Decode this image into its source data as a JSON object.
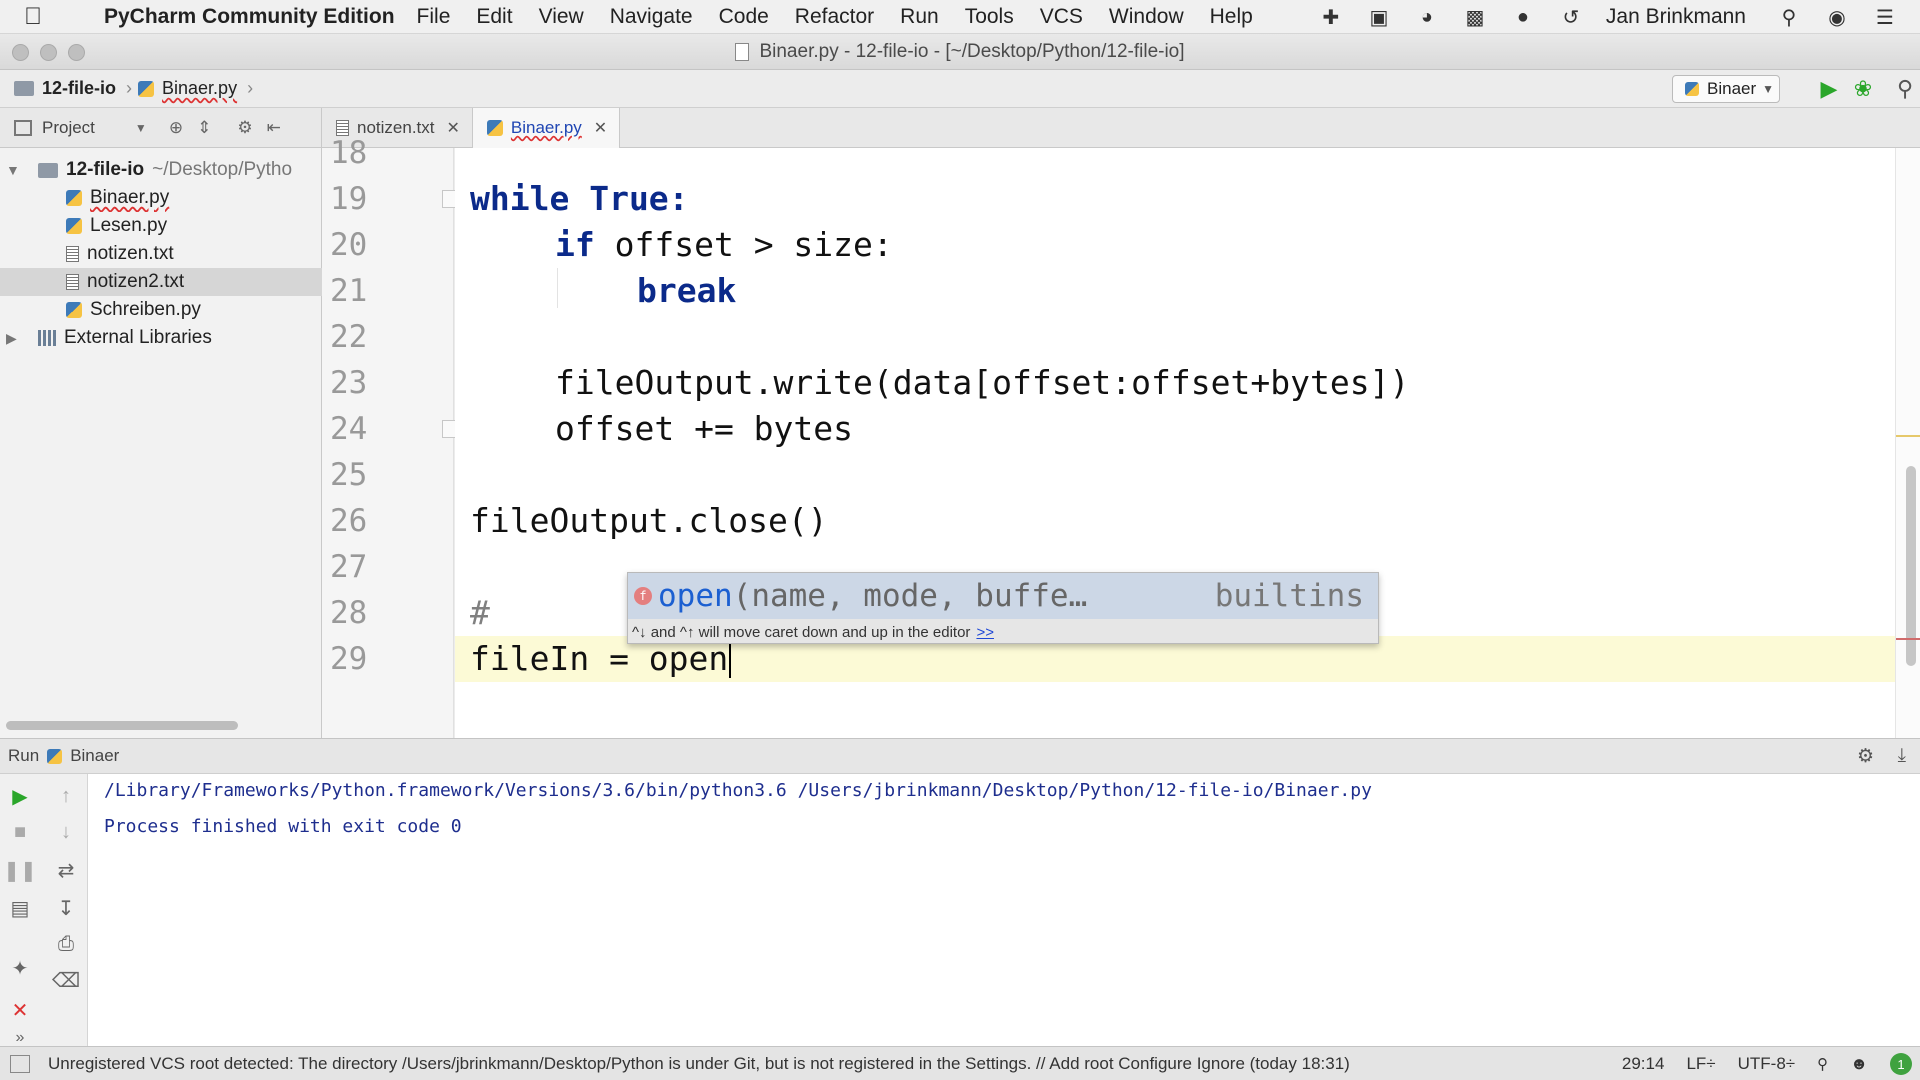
{
  "menubar": {
    "app_name": "PyCharm Community Edition",
    "items": [
      "File",
      "Edit",
      "View",
      "Navigate",
      "Code",
      "Refactor",
      "Run",
      "Tools",
      "VCS",
      "Window",
      "Help"
    ],
    "user": "Jan Brinkmann"
  },
  "window": {
    "title": "Binaer.py - 12-file-io - [~/Desktop/Python/12-file-io]"
  },
  "navbar": {
    "project": "12-file-io",
    "file": "Binaer.py",
    "run_config": "Binaer"
  },
  "tool_window": {
    "project_label": "Project"
  },
  "tabs": [
    {
      "label": "notizen.txt",
      "type": "txt",
      "active": false
    },
    {
      "label": "Binaer.py",
      "type": "py",
      "active": true
    }
  ],
  "tree": {
    "root": {
      "name": "12-file-io",
      "path": "~/Desktop/Pytho"
    },
    "files": [
      {
        "name": "Binaer.py",
        "type": "py"
      },
      {
        "name": "Lesen.py",
        "type": "py"
      },
      {
        "name": "notizen.txt",
        "type": "txt"
      },
      {
        "name": "notizen2.txt",
        "type": "txt",
        "selected": true
      },
      {
        "name": "Schreiben.py",
        "type": "py"
      }
    ],
    "external": "External Libraries"
  },
  "editor": {
    "line_numbers": [
      "18",
      "19",
      "20",
      "21",
      "22",
      "23",
      "24",
      "25",
      "26",
      "27",
      "28",
      "29"
    ],
    "lines": {
      "l19_kw": "while True:",
      "l20_kw": "if",
      "l20_rest": " offset > size:",
      "l21_kw": "break",
      "l23": "fileOutput.write(data[offset:offset+bytes])",
      "l24": "offset += bytes",
      "l26": "fileOutput.close()",
      "l28": "#",
      "l29": "fileIn = open"
    }
  },
  "completion": {
    "name": "open",
    "params": "(name, mode, buffe…",
    "source": "builtins",
    "hint": "^↓ and ^↑ will move caret down and up in the editor",
    "hint_link": ">>"
  },
  "run": {
    "label": "Run",
    "config": "Binaer",
    "command": "/Library/Frameworks/Python.framework/Versions/3.6/bin/python3.6 /Users/jbrinkmann/Desktop/Python/12-file-io/Binaer.py",
    "result": "Process finished with exit code 0"
  },
  "status": {
    "message": "Unregistered VCS root detected: The directory /Users/jbrinkmann/Desktop/Python is under Git, but is not registered in the Settings. // Add root  Configure  Ignore (today 18:31)",
    "position": "29:14",
    "line_sep": "LF÷",
    "encoding": "UTF-8÷",
    "badge": "1"
  }
}
